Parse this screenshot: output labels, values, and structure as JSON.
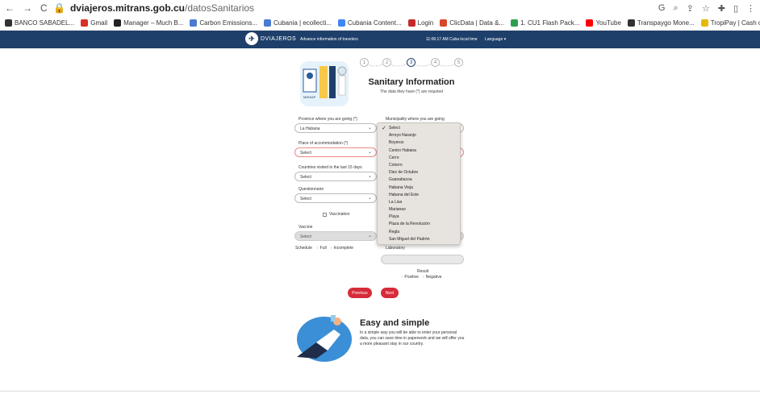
{
  "browser": {
    "url_host": "dviajeros.mitrans.gob.cu",
    "url_path": "/datosSanitarios",
    "bookmarks": [
      "BANCO SABADEL...",
      "Gmail",
      "Manager – Much B...",
      "Carbon Emissions...",
      "Cubania | ecollecti...",
      "Cubania Content...",
      "Login",
      "ClicData | Data &...",
      "1. CU1 Flash Pack...",
      "YouTube",
      "Transpaygo Mone...",
      "TropiPay | Cash ou..."
    ],
    "bookmark_colors": [
      "#333333",
      "#d93025",
      "#222222",
      "#4a7bd1",
      "#4a7bd1",
      "#4285f4",
      "#c62828",
      "#d6472b",
      "#2e9e4f",
      "#ff0000",
      "#333333",
      "#e6b800"
    ]
  },
  "header": {
    "logo_text": "DVIAJEROS",
    "tagline": "Advance information of travelers",
    "time": "11:06:17 AM Cuba local time",
    "language": "Language ▾"
  },
  "steps": [
    "1",
    "2",
    "3",
    "4",
    "5"
  ],
  "form": {
    "title": "Sanitary Information",
    "subtitle": "The data they have (*) are required",
    "province_label": "Province where you are going (*)",
    "province_value": "La Habana",
    "municipality_label": "Municipality where you are going",
    "accommodation_label": "Place of accommodation (*)",
    "accommodation_value": "Select",
    "countries_label": "Countries visited in the last 15 days",
    "countries_value": "Select",
    "questionnaire_label": "Questionnaire",
    "questionnaire_value": "Select",
    "vaccination_label": "Vaccination",
    "vaccine_label": "Vaccine",
    "vaccine_value": "Select",
    "schedule_label": "Schedule",
    "schedule_full": "Full",
    "schedule_incomplete": "Incomplete",
    "laboratory_label": "Laboratory",
    "result_label": "Result",
    "result_positive": "Positive",
    "result_negative": "Negative",
    "previous_label": "Previous",
    "next_label": "Next"
  },
  "municipality_dropdown": {
    "selected": "Select",
    "options": [
      "Select",
      "Arroyo Naranjo",
      "Boyeros",
      "Centro Habana",
      "Cerro",
      "Cotorro",
      "Diez de Octubre",
      "Guanabacoa",
      "Habana Vieja",
      "Habana del Este",
      "La Lisa",
      "Marianao",
      "Playa",
      "Plaza de la Revolución",
      "Regla",
      "San Miguel del Padrón"
    ]
  },
  "promo": {
    "title": "Easy and simple",
    "text": "In a simple way you will be able to enter your personal data, you can save time in paperwork and we will offer you a more pleasant stay in our country."
  },
  "colors": {
    "header_bg": "#1f3f6b",
    "button": "#d62b3a",
    "dropdown_bg": "#e7e3de"
  }
}
